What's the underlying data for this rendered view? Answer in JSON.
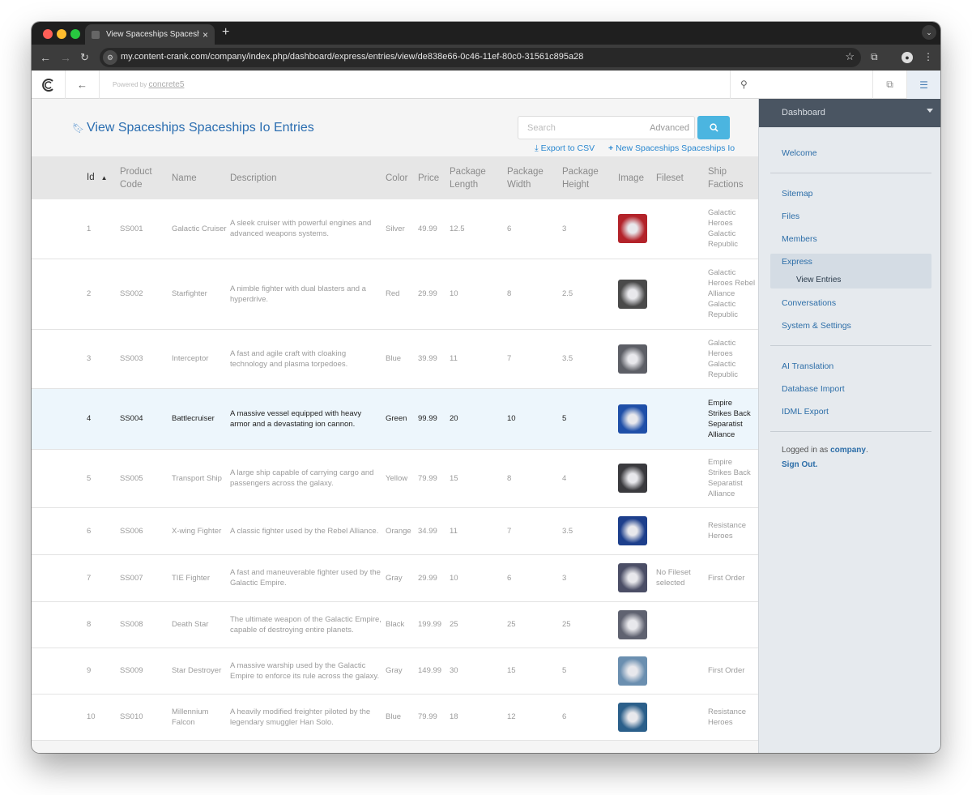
{
  "browser": {
    "tab_title": "View Spaceships Spaceships Io Entries",
    "url": "my.content-crank.com/company/index.php/dashboard/express/entries/view/de838e66-0c46-11ef-80c0-31561c895a28"
  },
  "cms": {
    "powered_prefix": "Powered by",
    "powered_brand": "concrete5"
  },
  "page": {
    "title": "View Spaceships Spaceships Io Entries",
    "search_placeholder": "Search",
    "advanced_label": "Advanced",
    "export_label": "Export to CSV",
    "new_label": "New Spaceships Spaceships Io"
  },
  "table": {
    "columns": [
      "Id",
      "Product Code",
      "Name",
      "Description",
      "Color",
      "Price",
      "Package Length",
      "Package Width",
      "Package Height",
      "Image",
      "Fileset",
      "Ship Factions"
    ],
    "rows": [
      {
        "id": "1",
        "code": "SS001",
        "name": "Galactic Cruiser",
        "desc": "A sleek cruiser with powerful engines and advanced weapons systems.",
        "color": "Silver",
        "price": "49.99",
        "length": "12.5",
        "width": "6",
        "height": "3",
        "fileset": "",
        "factions": "Galactic Heroes Galactic Republic",
        "thumb_color": "#b3232a"
      },
      {
        "id": "2",
        "code": "SS002",
        "name": "Starfighter",
        "desc": "A nimble fighter with dual blasters and a hyperdrive.",
        "color": "Red",
        "price": "29.99",
        "length": "10",
        "width": "8",
        "height": "2.5",
        "fileset": "",
        "factions": "Galactic Heroes Rebel Alliance Galactic Republic",
        "thumb_color": "#4a4a4a"
      },
      {
        "id": "3",
        "code": "SS003",
        "name": "Interceptor",
        "desc": "A fast and agile craft with cloaking technology and plasma torpedoes.",
        "color": "Blue",
        "price": "39.99",
        "length": "11",
        "width": "7",
        "height": "3.5",
        "fileset": "",
        "factions": "Galactic Heroes Galactic Republic",
        "thumb_color": "#5d5f66"
      },
      {
        "id": "4",
        "code": "SS004",
        "name": "Battlecruiser",
        "desc": "A massive vessel equipped with heavy armor and a devastating ion cannon.",
        "color": "Green",
        "price": "99.99",
        "length": "20",
        "width": "10",
        "height": "5",
        "fileset": "",
        "factions": "Empire Strikes Back Separatist Alliance",
        "thumb_color": "#1f4fa8"
      },
      {
        "id": "5",
        "code": "SS005",
        "name": "Transport Ship",
        "desc": "A large ship capable of carrying cargo and passengers across the galaxy.",
        "color": "Yellow",
        "price": "79.99",
        "length": "15",
        "width": "8",
        "height": "4",
        "fileset": "",
        "factions": "Empire Strikes Back Separatist Alliance",
        "thumb_color": "#3a3a3e"
      },
      {
        "id": "6",
        "code": "SS006",
        "name": "X-wing Fighter",
        "desc": "A classic fighter used by the Rebel Alliance.",
        "color": "Orange",
        "price": "34.99",
        "length": "11",
        "width": "7",
        "height": "3.5",
        "fileset": "",
        "factions": "Resistance Heroes",
        "thumb_color": "#1d3f8c"
      },
      {
        "id": "7",
        "code": "SS007",
        "name": "TIE Fighter",
        "desc": "A fast and maneuverable fighter used by the Galactic Empire.",
        "color": "Gray",
        "price": "29.99",
        "length": "10",
        "width": "6",
        "height": "3",
        "fileset": "No Fileset selected",
        "factions": "First Order",
        "thumb_color": "#4b4e66"
      },
      {
        "id": "8",
        "code": "SS008",
        "name": "Death Star",
        "desc": "The ultimate weapon of the Galactic Empire, capable of destroying entire planets.",
        "color": "Black",
        "price": "199.99",
        "length": "25",
        "width": "25",
        "height": "25",
        "fileset": "",
        "factions": "",
        "thumb_color": "#5f6270"
      },
      {
        "id": "9",
        "code": "SS009",
        "name": "Star Destroyer",
        "desc": "A massive warship used by the Galactic Empire to enforce its rule across the galaxy.",
        "color": "Gray",
        "price": "149.99",
        "length": "30",
        "width": "15",
        "height": "5",
        "fileset": "",
        "factions": "First Order",
        "thumb_color": "#6b8fb0"
      },
      {
        "id": "10",
        "code": "SS010",
        "name": "Millennium Falcon",
        "desc": "A heavily modified freighter piloted by the legendary smuggler Han Solo.",
        "color": "Blue",
        "price": "79.99",
        "length": "18",
        "width": "12",
        "height": "6",
        "fileset": "",
        "factions": "Resistance Heroes",
        "thumb_color": "#2b5f8a"
      }
    ]
  },
  "sidebar": {
    "header": "Dashboard",
    "items": {
      "welcome": "Welcome",
      "sitemap": "Sitemap",
      "files": "Files",
      "members": "Members",
      "express": "Express",
      "view_entries": "View Entries",
      "conversations": "Conversations",
      "system_settings": "System & Settings",
      "ai_translation": "AI Translation",
      "database_import": "Database Import",
      "idml_export": "IDML Export"
    },
    "logged_prefix": "Logged in as",
    "user": "company",
    "signout": "Sign Out."
  },
  "colors": {
    "accent": "#2a6db0",
    "search_button": "#4bb5e0",
    "highlight_row": "#edf6fc",
    "sidebar_header": "#4a5562"
  }
}
